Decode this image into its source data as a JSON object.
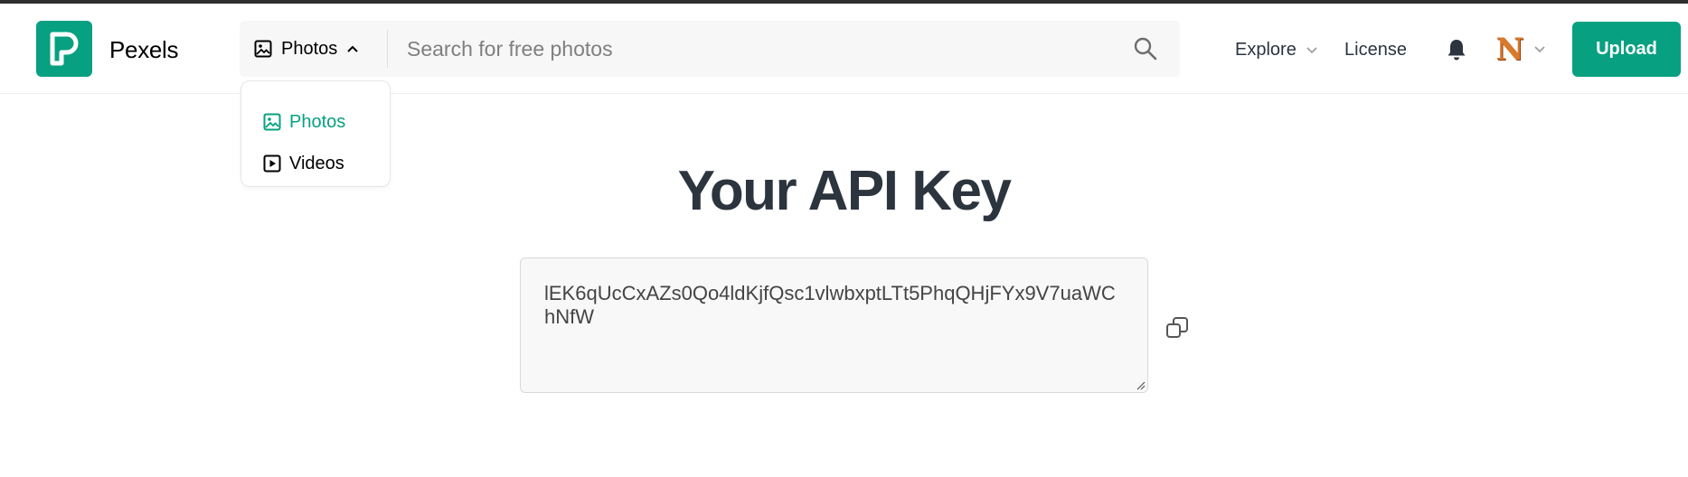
{
  "header": {
    "brand": "Pexels",
    "search": {
      "type_label": "Photos",
      "placeholder": "Search for free photos"
    },
    "nav": {
      "explore": "Explore",
      "license": "License"
    },
    "avatar_initial": "N",
    "upload_label": "Upload"
  },
  "type_dropdown": {
    "items": [
      {
        "label": "Photos",
        "icon": "image-icon",
        "active": true
      },
      {
        "label": "Videos",
        "icon": "play-square-icon",
        "active": false
      }
    ]
  },
  "main": {
    "title": "Your API Key",
    "api_key": "lEK6qUcCxAZs0Qo4ldKjfQsc1vlwbxptLTt5PhqQHjFYx9V7uaWChNfW"
  },
  "colors": {
    "brand_green": "#07a081",
    "text_dark": "#2c343e"
  }
}
